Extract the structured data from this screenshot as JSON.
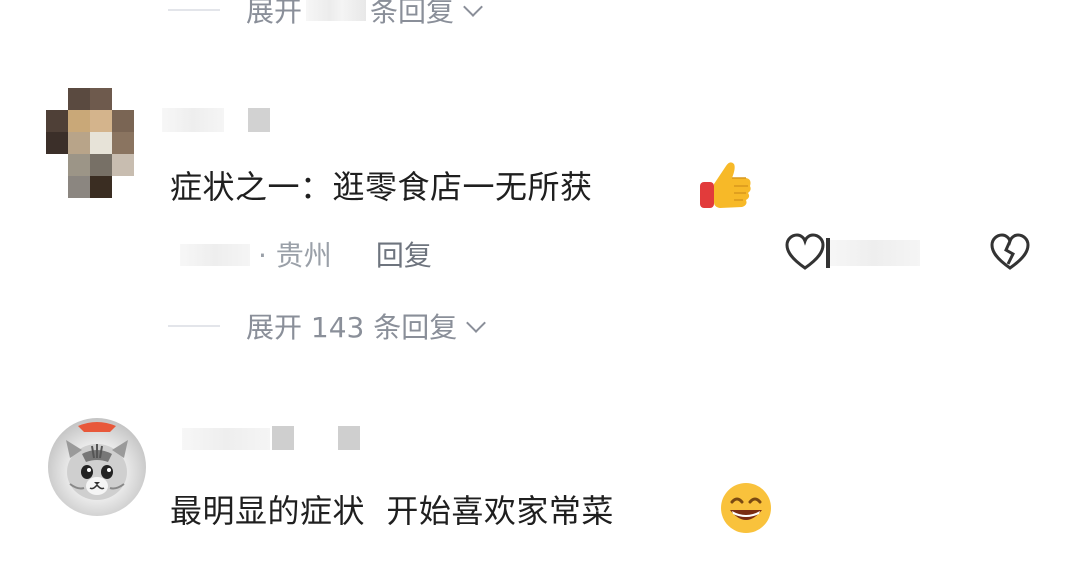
{
  "top_expand": {
    "prefix": "展开",
    "suffix": "条回复"
  },
  "comment1": {
    "text": "症状之一：逛零食店一无所获",
    "emoji_icon": "thumbs-up-icon",
    "location": "· 贵州",
    "reply_label": "回复",
    "expand_label": "展开 143 条回复"
  },
  "comment2": {
    "text": "最明显的症状  开始喜欢家常菜",
    "emoji_icon": "grinning-face-icon"
  },
  "colors": {
    "text": "#1f1f1f",
    "meta": "#9aa0a8",
    "link": "#6e747e"
  }
}
